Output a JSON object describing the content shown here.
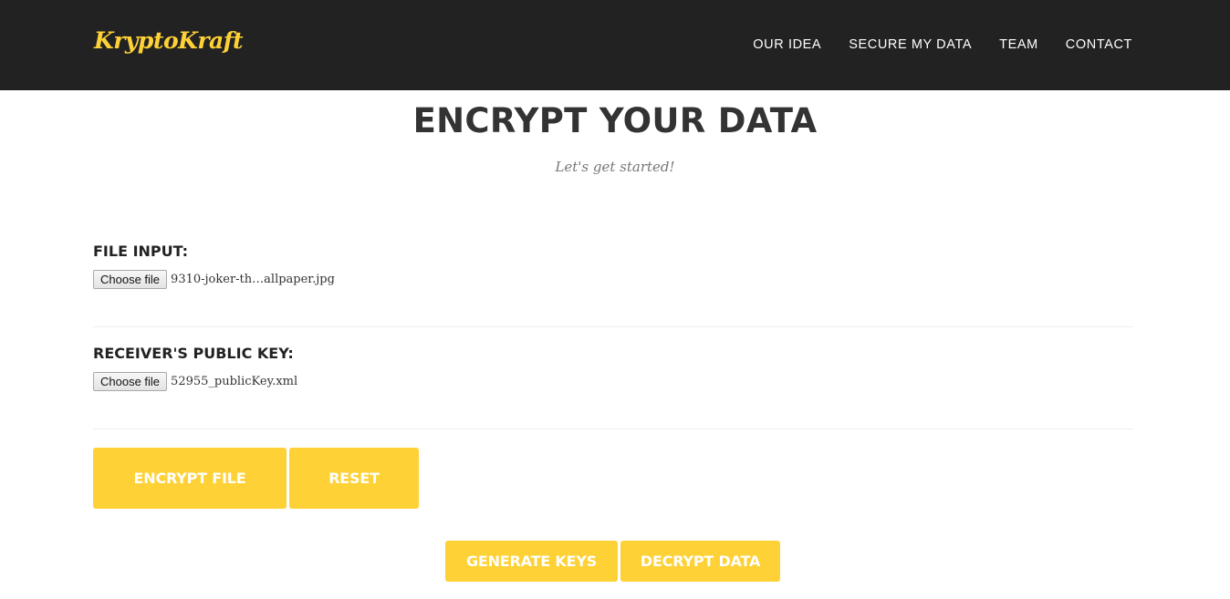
{
  "navbar": {
    "brand": "KryptoKraft",
    "links": [
      "OUR IDEA",
      "SECURE MY DATA",
      "TEAM",
      "CONTACT"
    ]
  },
  "header": {
    "title": "ENCRYPT YOUR DATA",
    "subtitle": "Let's get started!"
  },
  "file_input": {
    "label": "FILE INPUT:",
    "button": "Choose file",
    "filename": "9310-joker-th…allpaper.jpg"
  },
  "public_key": {
    "label": "RECEIVER'S PUBLIC KEY:",
    "button": "Choose file",
    "filename": "52955_publicKey.xml"
  },
  "actions": {
    "encrypt": "ENCRYPT FILE",
    "reset": "RESET",
    "generate": "GENERATE KEYS",
    "decrypt": "DECRYPT DATA"
  },
  "colors": {
    "navbar_bg": "#222222",
    "accent": "#fed136",
    "text": "#333333"
  }
}
